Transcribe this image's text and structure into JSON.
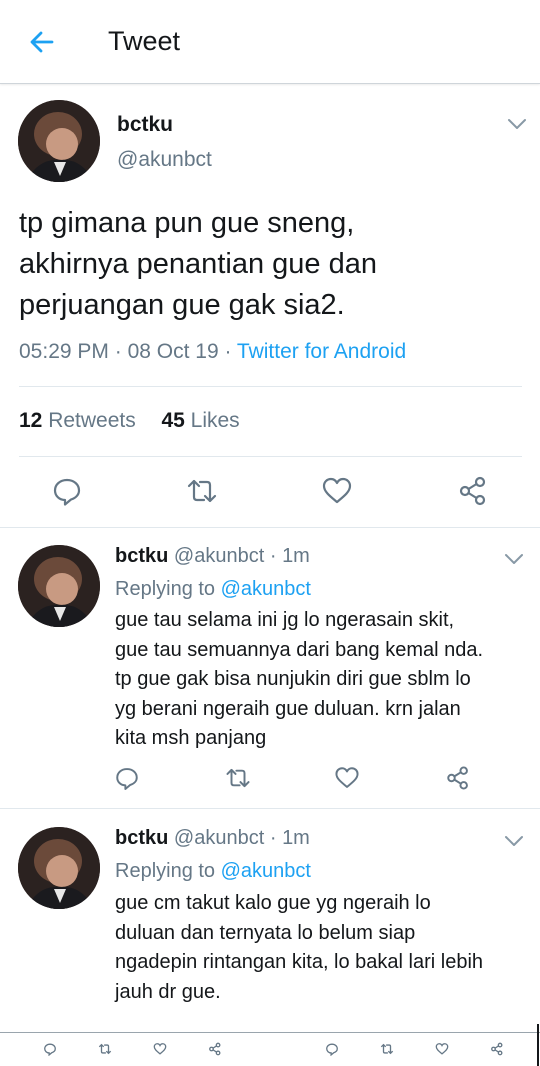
{
  "header": {
    "title": "Tweet"
  },
  "main_tweet": {
    "name": "bctku",
    "handle": "@akunbct",
    "text_lines": [
      "tp gimana pun gue sneng,",
      "akhirnya penantian gue dan",
      "perjuangan gue gak sia2."
    ],
    "time": "05:29 PM",
    "date": "08 Oct 19",
    "source": "Twitter for Android",
    "retweets_count": "12",
    "retweets_label": "Retweets",
    "likes_count": "45",
    "likes_label": "Likes"
  },
  "replies": [
    {
      "name": "bctku",
      "handle": "@akunbct",
      "time": "1m",
      "replying_label": "Replying to",
      "replying_handle": "@akunbct",
      "text_lines": [
        "gue tau selama ini jg lo ngerasain skit,",
        "gue tau semuannya dari bang kemal nda.",
        "tp gue gak bisa nunjukin diri gue sblm lo",
        "yg berani ngeraih gue duluan. krn jalan",
        "kita msh panjang"
      ]
    },
    {
      "name": "bctku",
      "handle": "@akunbct",
      "time": "1m",
      "replying_label": "Replying to",
      "replying_handle": "@akunbct",
      "text_lines": [
        "gue cm takut kalo gue yg ngeraih lo",
        "duluan dan ternyata lo belum siap",
        "ngadepin rintangan kita, lo bakal lari lebih",
        "jauh dr gue."
      ]
    }
  ],
  "colors": {
    "accent": "#1da1f2",
    "secondary_text": "#657786",
    "icon": "#657786",
    "primary_text": "#14171a"
  }
}
